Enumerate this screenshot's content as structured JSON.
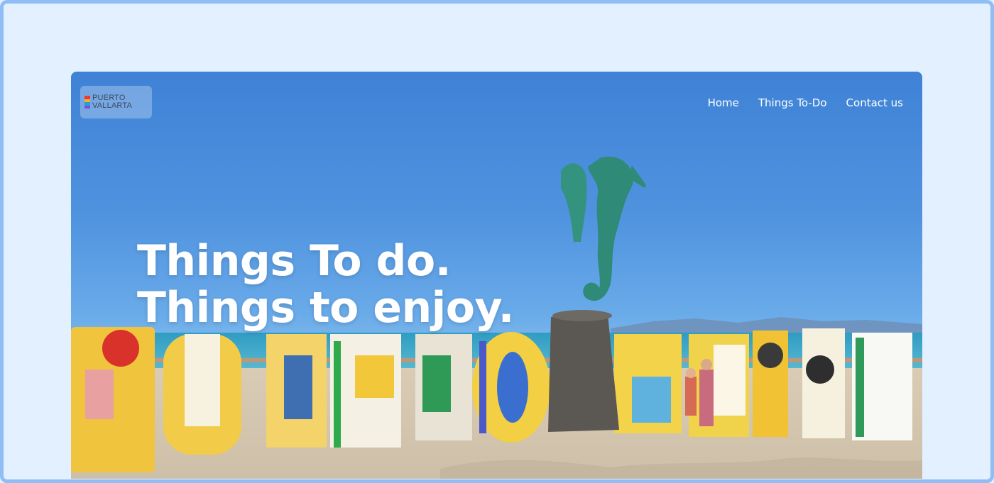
{
  "logo": {
    "line1": "PUERTO",
    "line2": "VALLARTA"
  },
  "nav": {
    "items": [
      "Home",
      "Things To-Do",
      "Contact us"
    ]
  },
  "hero": {
    "line1": "Things To do.",
    "line2": "Things to enjoy."
  },
  "colors": {
    "page_background": "#e3f0ff",
    "frame_border": "#8fbdf5",
    "sky": "#4f93df",
    "text": "#ffffff"
  }
}
